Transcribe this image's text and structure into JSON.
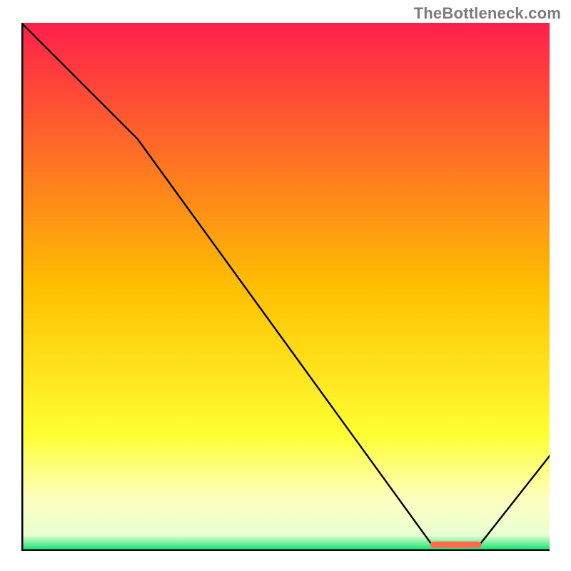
{
  "watermark": "TheBottleneck.com",
  "chart_data": {
    "type": "line",
    "title": "",
    "xlabel": "",
    "ylabel": "",
    "xlim": [
      0,
      100
    ],
    "ylim": [
      0,
      100
    ],
    "grid": false,
    "legend": null,
    "gradient_stops": [
      {
        "offset": 0.0,
        "color": "#ff1f4b"
      },
      {
        "offset": 0.5,
        "color": "#ffbf00"
      },
      {
        "offset": 0.78,
        "color": "#ffff33"
      },
      {
        "offset": 0.9,
        "color": "#fdffbf"
      },
      {
        "offset": 0.97,
        "color": "#e9ffd3"
      },
      {
        "offset": 1.0,
        "color": "#00e06a"
      }
    ],
    "curve_points": [
      {
        "x": 0.0,
        "y": 100.0
      },
      {
        "x": 22.0,
        "y": 78.0
      },
      {
        "x": 77.5,
        "y": 1.5
      },
      {
        "x": 82.5,
        "y": 1.0
      },
      {
        "x": 87.0,
        "y": 1.5
      },
      {
        "x": 100.0,
        "y": 18.0
      }
    ],
    "marker_band": {
      "x_start": 78.0,
      "x_end": 86.5,
      "y": 1.2,
      "color": "#ff6a4d"
    }
  }
}
